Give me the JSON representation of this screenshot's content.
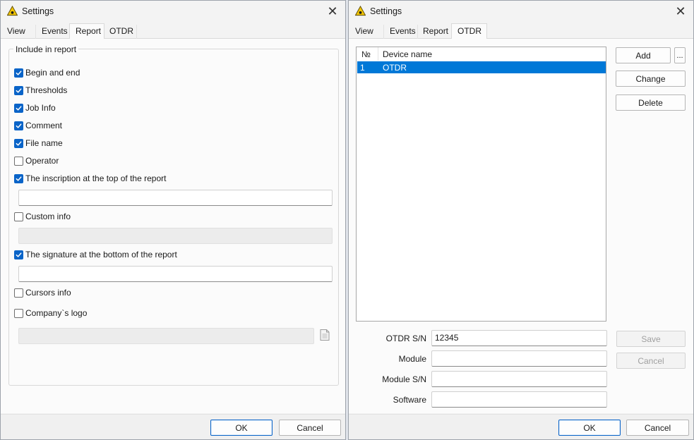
{
  "colors": {
    "accent": "#0a64c8",
    "selection": "#0078d7",
    "warning_icon": "#f2c500"
  },
  "left_dialog": {
    "title": "Settings",
    "icon": "warning-triangle-icon",
    "tabs": [
      "View",
      "Events",
      "Report",
      "OTDR"
    ],
    "active_tab": "Report",
    "group_title": "Include in report",
    "options": [
      {
        "label": "Begin and end",
        "checked": true
      },
      {
        "label": "Thresholds",
        "checked": true
      },
      {
        "label": "Job Info",
        "checked": true
      },
      {
        "label": "Comment",
        "checked": true
      },
      {
        "label": "File name",
        "checked": true
      },
      {
        "label": "Operator",
        "checked": false
      },
      {
        "label": "The inscription at the top of the report",
        "checked": true
      },
      {
        "label": "Custom info",
        "checked": false
      },
      {
        "label": "The signature at the bottom of the report",
        "checked": true
      },
      {
        "label": "Cursors info",
        "checked": false
      },
      {
        "label": "Company`s logo",
        "checked": false
      }
    ],
    "ok_label": "OK",
    "cancel_label": "Cancel"
  },
  "right_dialog": {
    "title": "Settings",
    "icon": "warning-triangle-icon",
    "tabs": [
      "View",
      "Events",
      "Report",
      "OTDR"
    ],
    "active_tab": "OTDR",
    "device_list": {
      "columns": [
        "№",
        "Device name"
      ],
      "rows": [
        {
          "num": "1",
          "name": "OTDR",
          "selected": true
        }
      ]
    },
    "buttons": {
      "add": "Add",
      "more": "...",
      "change": "Change",
      "delete": "Delete",
      "save": "Save",
      "cancel": "Cancel"
    },
    "fields": [
      {
        "label": "OTDR S/N",
        "value": "12345"
      },
      {
        "label": "Module",
        "value": ""
      },
      {
        "label": "Module S/N",
        "value": ""
      },
      {
        "label": "Software",
        "value": ""
      }
    ],
    "ok_label": "OK",
    "cancel_label": "Cancel"
  }
}
